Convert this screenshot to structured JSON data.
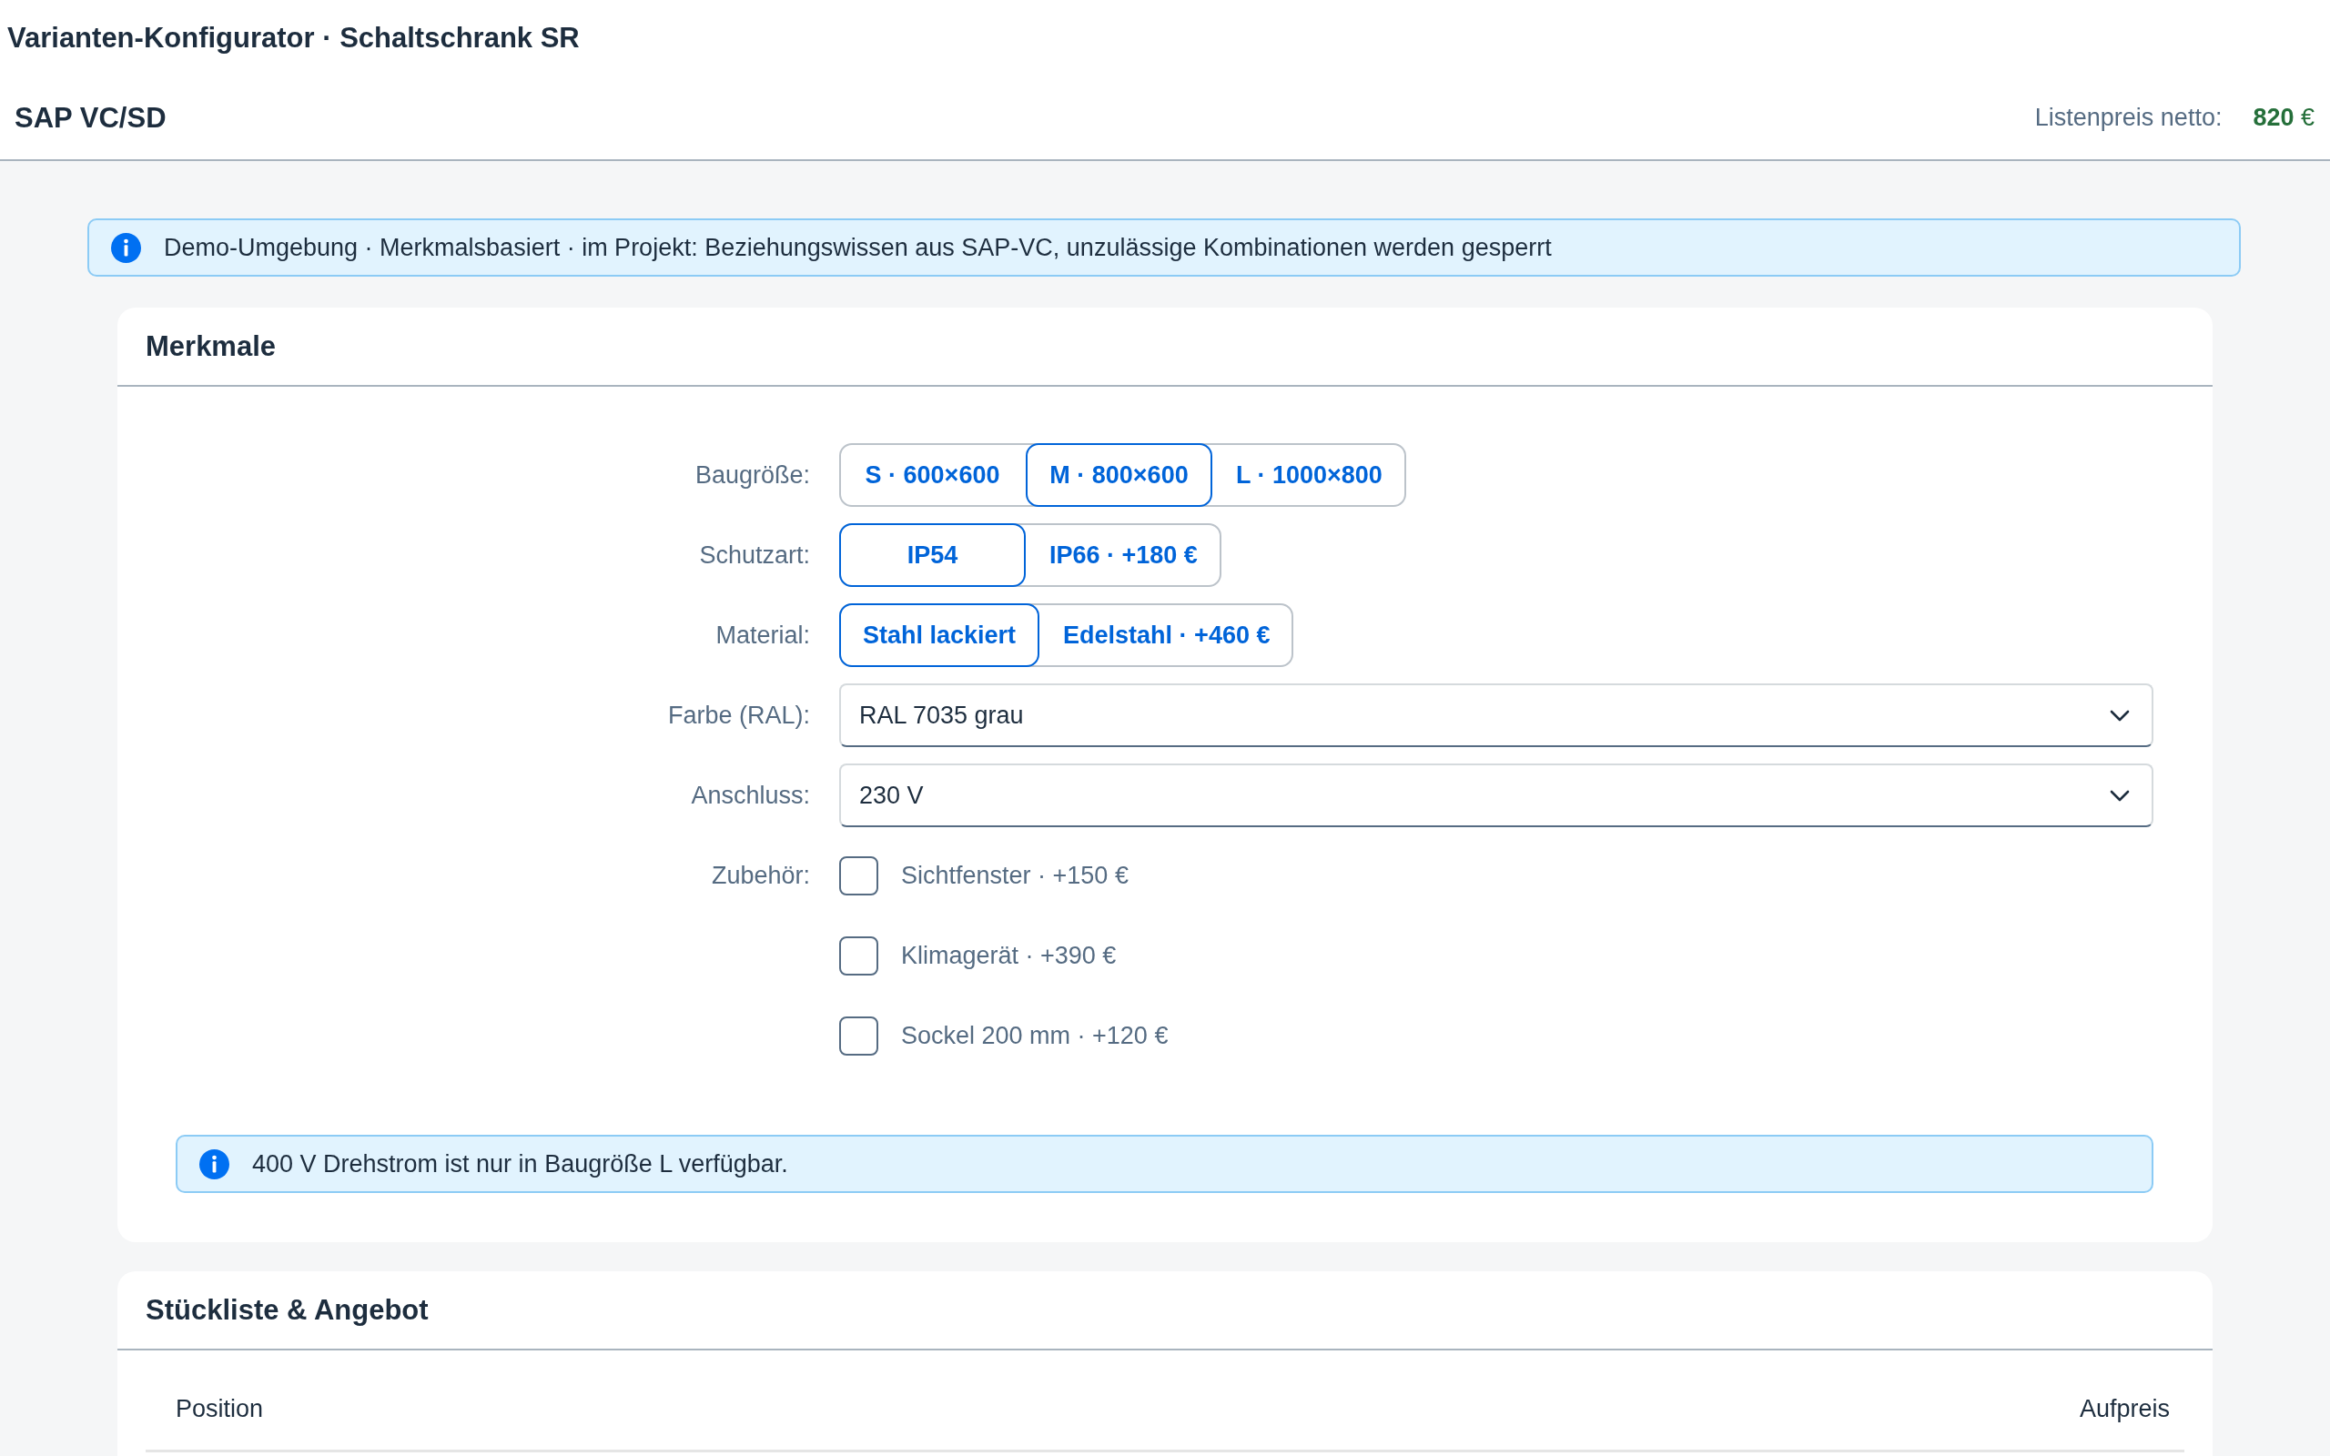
{
  "page_title": "Varianten-Konfigurator · Schaltschrank SR",
  "shell_bar": {
    "title": "SAP VC/SD",
    "price_label": "Listenpreis netto:",
    "price_value": "**820** €"
  },
  "info_banner": {
    "text": "Demo-Umgebung · Merkmalsbasiert · im Projekt: Beziehungswissen aus SAP-VC, unzulässige Kombinationen werden gesperrt"
  },
  "characteristics_panel": {
    "title": "Merkmale",
    "fields": [
      {
        "kind": "segmented",
        "label": "Baugröße:",
        "options": [
          {
            "label": "S · 600×600",
            "selected": false
          },
          {
            "label": "M · 800×600",
            "selected": true
          },
          {
            "label": "L · 1000×800",
            "selected": false
          }
        ]
      },
      {
        "kind": "segmented",
        "label": "Schutzart:",
        "options": [
          {
            "label": "IP54",
            "selected": true
          },
          {
            "label": "IP66 · +180 €",
            "selected": false
          }
        ]
      },
      {
        "kind": "segmented",
        "label": "Material:",
        "options": [
          {
            "label": "Stahl lackiert",
            "selected": true
          },
          {
            "label": "Edelstahl · +460 €",
            "selected": false
          }
        ]
      },
      {
        "kind": "select",
        "label": "Farbe (RAL):",
        "value": "RAL 7035 grau"
      },
      {
        "kind": "select",
        "label": "Anschluss:",
        "value": "230 V"
      },
      {
        "kind": "checkboxes",
        "label": "Zubehör:",
        "options": [
          {
            "label": "Sichtfenster · +150 €",
            "checked": false
          },
          {
            "label": "Klimagerät · +390 €",
            "checked": false
          },
          {
            "label": "Sockel 200 mm · +120 €",
            "checked": false
          }
        ]
      }
    ],
    "message": {
      "text": "400 V Drehstrom ist nur in Baugröße L verfügbar."
    }
  },
  "bom_panel": {
    "title": "Stückliste & Angebot",
    "table": {
      "columns": [
        "Position",
        "Aufpreis"
      ]
    }
  }
}
